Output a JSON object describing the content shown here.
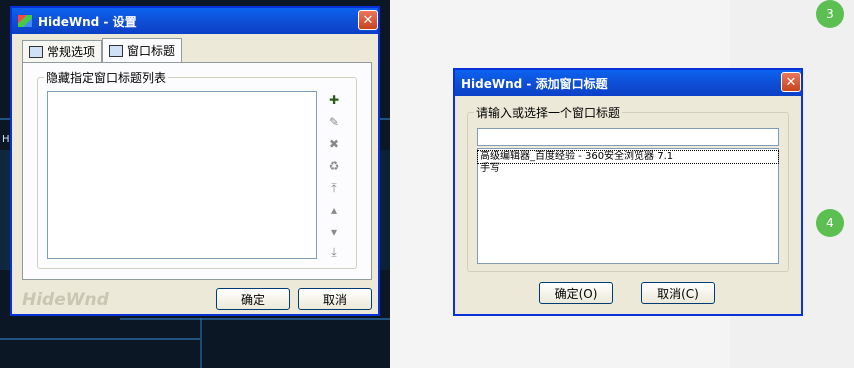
{
  "background": {
    "left_letter": "H",
    "steps": [
      "3",
      "4"
    ],
    "step_color": "#5cbf52"
  },
  "settings_window": {
    "title": "HideWnd - 设置",
    "tabs": [
      {
        "label": "常规选项",
        "icon": "general-options-icon"
      },
      {
        "label": "窗口标题",
        "icon": "window-titles-icon"
      }
    ],
    "group_label": "隐藏指定窗口标题列表",
    "side_icons": [
      "add-icon",
      "edit-icon",
      "remove-icon",
      "clear-icon",
      "move-top-icon",
      "move-up-icon",
      "move-down-icon",
      "move-bottom-icon"
    ],
    "brand": "HideWnd",
    "ok_label": "确定",
    "cancel_label": "取消"
  },
  "add_title_dialog": {
    "title": "HideWnd - 添加窗口标题",
    "group_label": "请输入或选择一个窗口标题",
    "input_value": "",
    "list_items": [
      "高级编辑器_百度经验 - 360安全浏览器 7.1",
      "手写"
    ],
    "ok_label": "确定(O)",
    "cancel_label": "取消(C)"
  },
  "colors": {
    "titlebar": "#0a63f0",
    "dialog_face": "#ece9d8",
    "close_button": "#c7441e"
  }
}
